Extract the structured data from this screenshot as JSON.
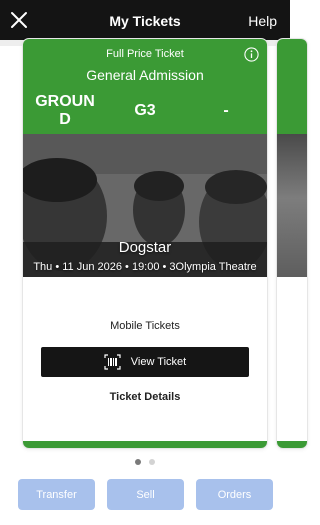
{
  "header": {
    "title": "My Tickets",
    "help_label": "Help",
    "close_icon": "close-icon"
  },
  "ticket": {
    "price_type": "Full Price Ticket",
    "admission": "General Admission",
    "section": "GROUN D",
    "row": "G3",
    "seat": "-",
    "event_name": "Dogstar",
    "event_details": "Thu • 11 Jun 2026 • 19:00 • 3Olympia Theatre",
    "mobile_tickets_label": "Mobile Tickets",
    "view_ticket_label": "View Ticket",
    "ticket_details_label": "Ticket Details"
  },
  "pager": {
    "total": 2,
    "active": 1
  },
  "actions": {
    "transfer": "Transfer",
    "sell": "Sell",
    "orders": "Orders"
  },
  "colors": {
    "header_bg": "#141414",
    "ticket_green": "#3b9a35",
    "action_button": "#a8c1ec",
    "view_ticket_bg": "#151515"
  }
}
